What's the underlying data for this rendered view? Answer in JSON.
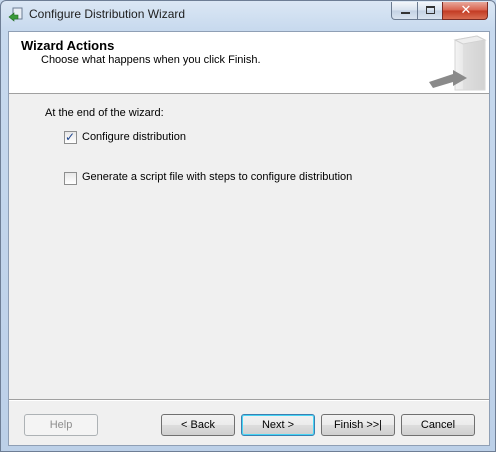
{
  "window": {
    "title": "Configure Distribution Wizard",
    "caption_buttons": {
      "minimize_icon": "minimize-icon",
      "maximize_icon": "maximize-icon",
      "close_glyph": "✕"
    }
  },
  "header": {
    "title": "Wizard Actions",
    "subtitle": "Choose what happens when you click Finish."
  },
  "body": {
    "prompt": "At the end of the wizard:",
    "options": [
      {
        "label": "Configure distribution",
        "checked": true
      },
      {
        "label": "Generate a script file with steps to configure distribution",
        "checked": false
      }
    ]
  },
  "footer": {
    "help": "Help",
    "back": "< Back",
    "next": "Next >",
    "finish": "Finish >>|",
    "cancel": "Cancel"
  },
  "colors": {
    "accent": "#3c7fb1",
    "close": "#c23a22"
  }
}
